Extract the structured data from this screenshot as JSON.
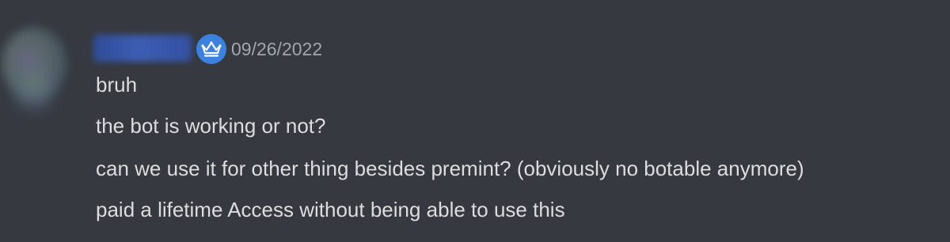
{
  "message": {
    "username": "",
    "badge_icon": "crown-icon",
    "badge_color": "#3b82e0",
    "timestamp": "09/26/2022",
    "lines": [
      "bruh",
      "the bot is working or not?",
      "can we use it for other thing besides premint? (obviously no botable anymore)",
      "paid a lifetime Access without being able to use this"
    ]
  }
}
